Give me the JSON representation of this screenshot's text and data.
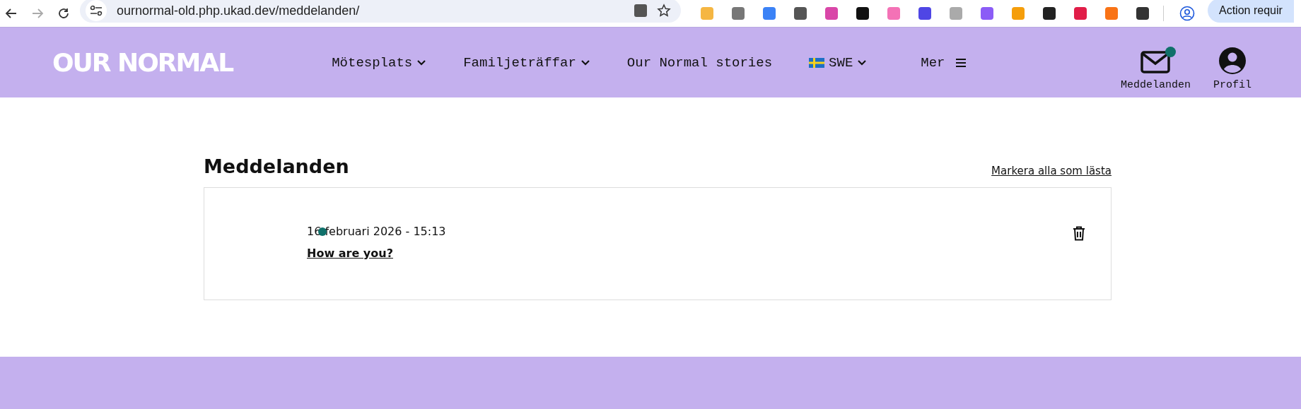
{
  "browser": {
    "url": "ournormal-old.php.ukad.dev/meddelanden/",
    "action_label": "Action requir"
  },
  "header": {
    "logo": "OUR NORMAL",
    "nav": [
      {
        "label": "Mötesplats",
        "kind": "dropdown"
      },
      {
        "label": "Familjeträffar",
        "kind": "dropdown"
      },
      {
        "label": "Our Normal stories",
        "kind": "link"
      },
      {
        "label": "SWE",
        "kind": "language"
      },
      {
        "label": "Mer",
        "kind": "menu"
      }
    ],
    "messages": {
      "label": "Meddelanden",
      "unread": true
    },
    "profile": {
      "label": "Profil"
    }
  },
  "page": {
    "title": "Meddelanden",
    "mark_all": "Markera alla som lästa",
    "messages": [
      {
        "date": "16 februari 2026 - 15:13",
        "subject": "How are you?",
        "unread": true
      }
    ]
  }
}
